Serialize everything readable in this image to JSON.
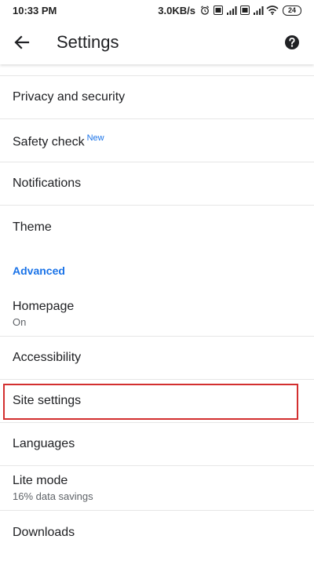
{
  "status_bar": {
    "time": "10:33 PM",
    "speed": "3.0KB/s",
    "battery": "24"
  },
  "app_bar": {
    "title": "Settings"
  },
  "colors": {
    "accent": "#1a73e8",
    "highlight": "#d32f2f"
  },
  "items": {
    "privacy": {
      "label": "Privacy and security"
    },
    "safety": {
      "label": "Safety check",
      "badge": "New"
    },
    "notifications": {
      "label": "Notifications"
    },
    "theme": {
      "label": "Theme"
    },
    "advanced": {
      "label": "Advanced"
    },
    "homepage": {
      "label": "Homepage",
      "sub": "On"
    },
    "accessibility": {
      "label": "Accessibility"
    },
    "site_settings": {
      "label": "Site settings"
    },
    "languages": {
      "label": "Languages"
    },
    "lite_mode": {
      "label": "Lite mode",
      "sub": "16% data savings"
    },
    "downloads": {
      "label": "Downloads"
    }
  }
}
